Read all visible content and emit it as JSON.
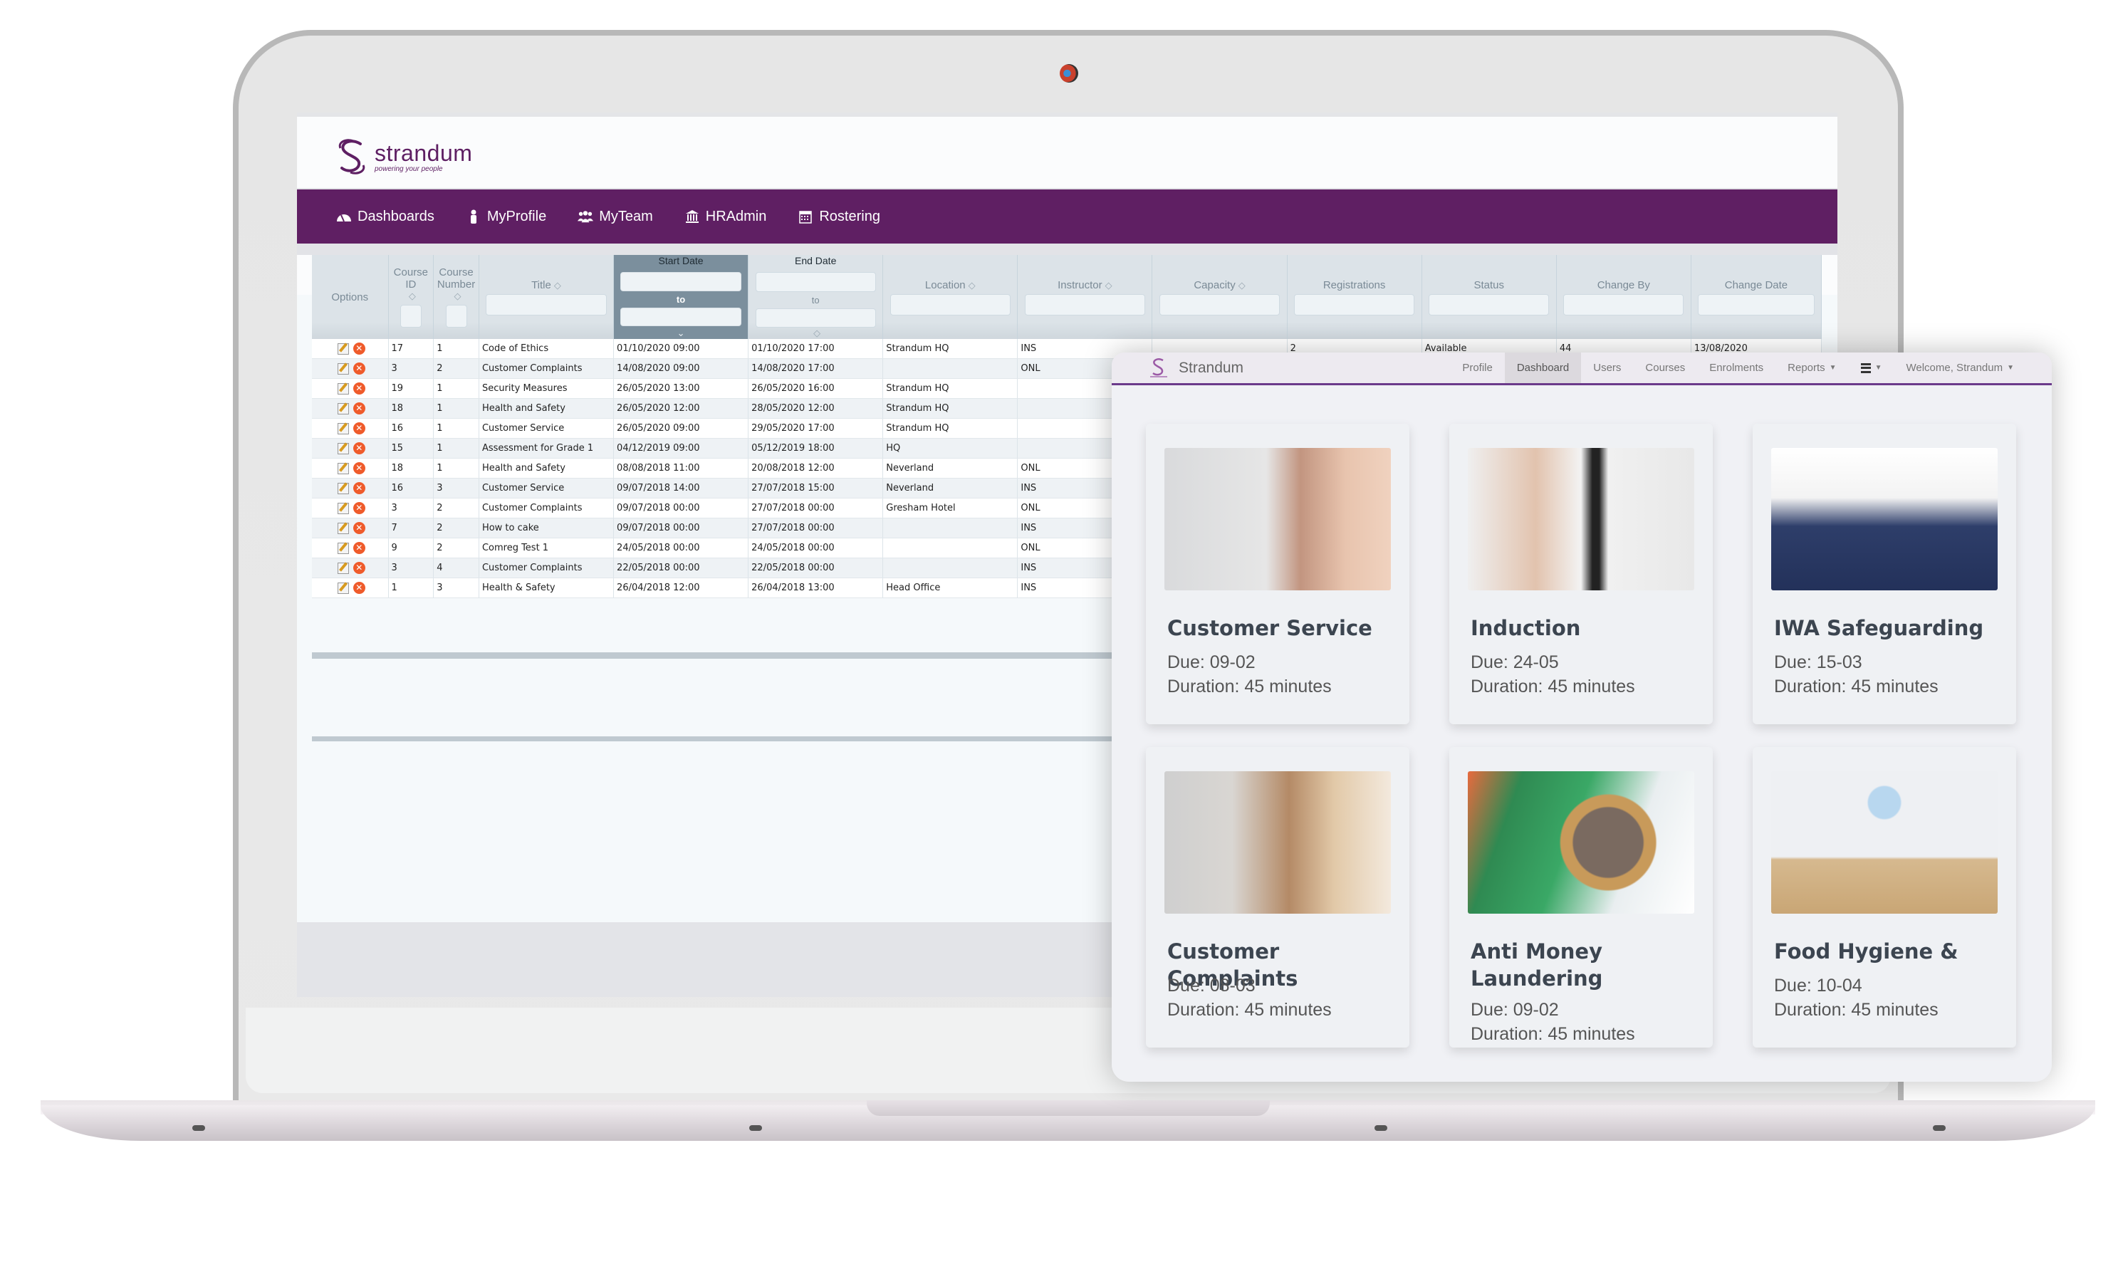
{
  "app": {
    "brand_name": "strandum",
    "tagline": "powering your people"
  },
  "nav": {
    "items": [
      {
        "label": "Dashboards",
        "icon": "dashboard-icon"
      },
      {
        "label": "MyProfile",
        "icon": "user-icon"
      },
      {
        "label": "MyTeam",
        "icon": "users-icon"
      },
      {
        "label": "HRAdmin",
        "icon": "bank-icon"
      },
      {
        "label": "Rostering",
        "icon": "calendar-icon"
      }
    ]
  },
  "table": {
    "columns": {
      "options": "Options",
      "course_id": "Course ID",
      "course_number": "Course Number",
      "title": "Title",
      "start_date": "Start Date",
      "end_date": "End Date",
      "location": "Location",
      "instructor": "Instructor",
      "capacity": "Capacity",
      "registrations": "Registrations",
      "status": "Status",
      "change_by": "Change By",
      "change_date": "Change Date"
    },
    "range_to": "to",
    "sort_icon": "◇",
    "rows": [
      {
        "id": "17",
        "num": "1",
        "title": "Code of Ethics",
        "start": "01/10/2020 09:00",
        "end": "01/10/2020 17:00",
        "location": "Strandum HQ",
        "instructor": "INS",
        "capacity": "",
        "registrations": "2",
        "status": "Available",
        "change_by": "44",
        "change_date": "13/08/2020"
      },
      {
        "id": "3",
        "num": "2",
        "title": "Customer Complaints",
        "start": "14/08/2020 09:00",
        "end": "14/08/2020 17:00",
        "location": "",
        "instructor": "ONL",
        "capacity": "",
        "registrations": "",
        "status": "",
        "change_by": "",
        "change_date": ""
      },
      {
        "id": "19",
        "num": "1",
        "title": "Security Measures",
        "start": "26/05/2020 13:00",
        "end": "26/05/2020 16:00",
        "location": "Strandum HQ",
        "instructor": "",
        "capacity": "",
        "registrations": "",
        "status": "",
        "change_by": "",
        "change_date": ""
      },
      {
        "id": "18",
        "num": "1",
        "title": "Health and Safety",
        "start": "26/05/2020 12:00",
        "end": "28/05/2020 12:00",
        "location": "Strandum HQ",
        "instructor": "",
        "capacity": "",
        "registrations": "",
        "status": "",
        "change_by": "",
        "change_date": ""
      },
      {
        "id": "16",
        "num": "1",
        "title": "Customer Service",
        "start": "26/05/2020 09:00",
        "end": "29/05/2020 17:00",
        "location": "Strandum HQ",
        "instructor": "",
        "capacity": "",
        "registrations": "",
        "status": "",
        "change_by": "",
        "change_date": ""
      },
      {
        "id": "15",
        "num": "1",
        "title": "Assessment for Grade 1",
        "start": "04/12/2019 09:00",
        "end": "05/12/2019 18:00",
        "location": "HQ",
        "instructor": "",
        "capacity": "",
        "registrations": "",
        "status": "",
        "change_by": "",
        "change_date": ""
      },
      {
        "id": "18",
        "num": "1",
        "title": "Health and Safety",
        "start": "08/08/2018 11:00",
        "end": "20/08/2018 12:00",
        "location": "Neverland",
        "instructor": "ONL",
        "capacity": "",
        "registrations": "",
        "status": "",
        "change_by": "",
        "change_date": ""
      },
      {
        "id": "16",
        "num": "3",
        "title": "Customer Service",
        "start": "09/07/2018 14:00",
        "end": "27/07/2018 15:00",
        "location": "Neverland",
        "instructor": "INS",
        "capacity": "",
        "registrations": "",
        "status": "",
        "change_by": "",
        "change_date": ""
      },
      {
        "id": "3",
        "num": "2",
        "title": "Customer Complaints",
        "start": "09/07/2018 00:00",
        "end": "27/07/2018 00:00",
        "location": "Gresham Hotel",
        "instructor": "ONL",
        "capacity": "",
        "registrations": "",
        "status": "",
        "change_by": "",
        "change_date": ""
      },
      {
        "id": "7",
        "num": "2",
        "title": "How to cake",
        "start": "09/07/2018 00:00",
        "end": "27/07/2018 00:00",
        "location": "",
        "instructor": "INS",
        "capacity": "",
        "registrations": "",
        "status": "",
        "change_by": "",
        "change_date": ""
      },
      {
        "id": "9",
        "num": "2",
        "title": "Comreg Test 1",
        "start": "24/05/2018 00:00",
        "end": "24/05/2018 00:00",
        "location": "",
        "instructor": "ONL",
        "capacity": "",
        "registrations": "",
        "status": "",
        "change_by": "",
        "change_date": ""
      },
      {
        "id": "3",
        "num": "4",
        "title": "Customer Complaints",
        "start": "22/05/2018 00:00",
        "end": "22/05/2018 00:00",
        "location": "",
        "instructor": "INS",
        "capacity": "",
        "registrations": "",
        "status": "",
        "change_by": "",
        "change_date": ""
      },
      {
        "id": "1",
        "num": "3",
        "title": "Health & Safety",
        "start": "26/04/2018 12:00",
        "end": "26/04/2018 13:00",
        "location": "Head Office",
        "instructor": "INS",
        "capacity": "",
        "registrations": "",
        "status": "",
        "change_by": "",
        "change_date": ""
      }
    ]
  },
  "dashboard": {
    "brand_name": "Strandum",
    "nav": {
      "profile": "Profile",
      "dashboard": "Dashboard",
      "users": "Users",
      "courses": "Courses",
      "enrolments": "Enrolments",
      "reports": "Reports",
      "welcome": "Welcome, Strandum"
    },
    "active_tab": "Dashboard",
    "cards": [
      {
        "title": "Customer Service",
        "due": "Due: 09-02",
        "duration": "Duration: 45 minutes",
        "image": "headset-agent-photo"
      },
      {
        "title": "Induction",
        "due": "Due: 24-05",
        "duration": "Duration: 45 minutes",
        "image": "handshake-photo"
      },
      {
        "title": "IWA Safeguarding",
        "due": "Due: 15-03",
        "duration": "Duration: 45 minutes",
        "image": "security-guard-photo"
      },
      {
        "title": "Customer Complaints",
        "due": "Due: 08-03",
        "duration": "Duration: 45 minutes",
        "image": "waiter-customer-photo"
      },
      {
        "title": "Anti Money Laundering",
        "due": "Due: 09-02",
        "duration": "Duration: 45 minutes",
        "image": "euro-coin-photo"
      },
      {
        "title": "Food Hygiene &",
        "due": "Due: 10-04",
        "duration": "Duration: 45 minutes",
        "image": "groceries-mask-photo"
      }
    ]
  },
  "colors": {
    "brand_purple": "#5f1f63",
    "overlay_accent": "#6b3a8a",
    "delete_icon": "#ef5b2b",
    "selected_header": "#7b8f9d"
  }
}
